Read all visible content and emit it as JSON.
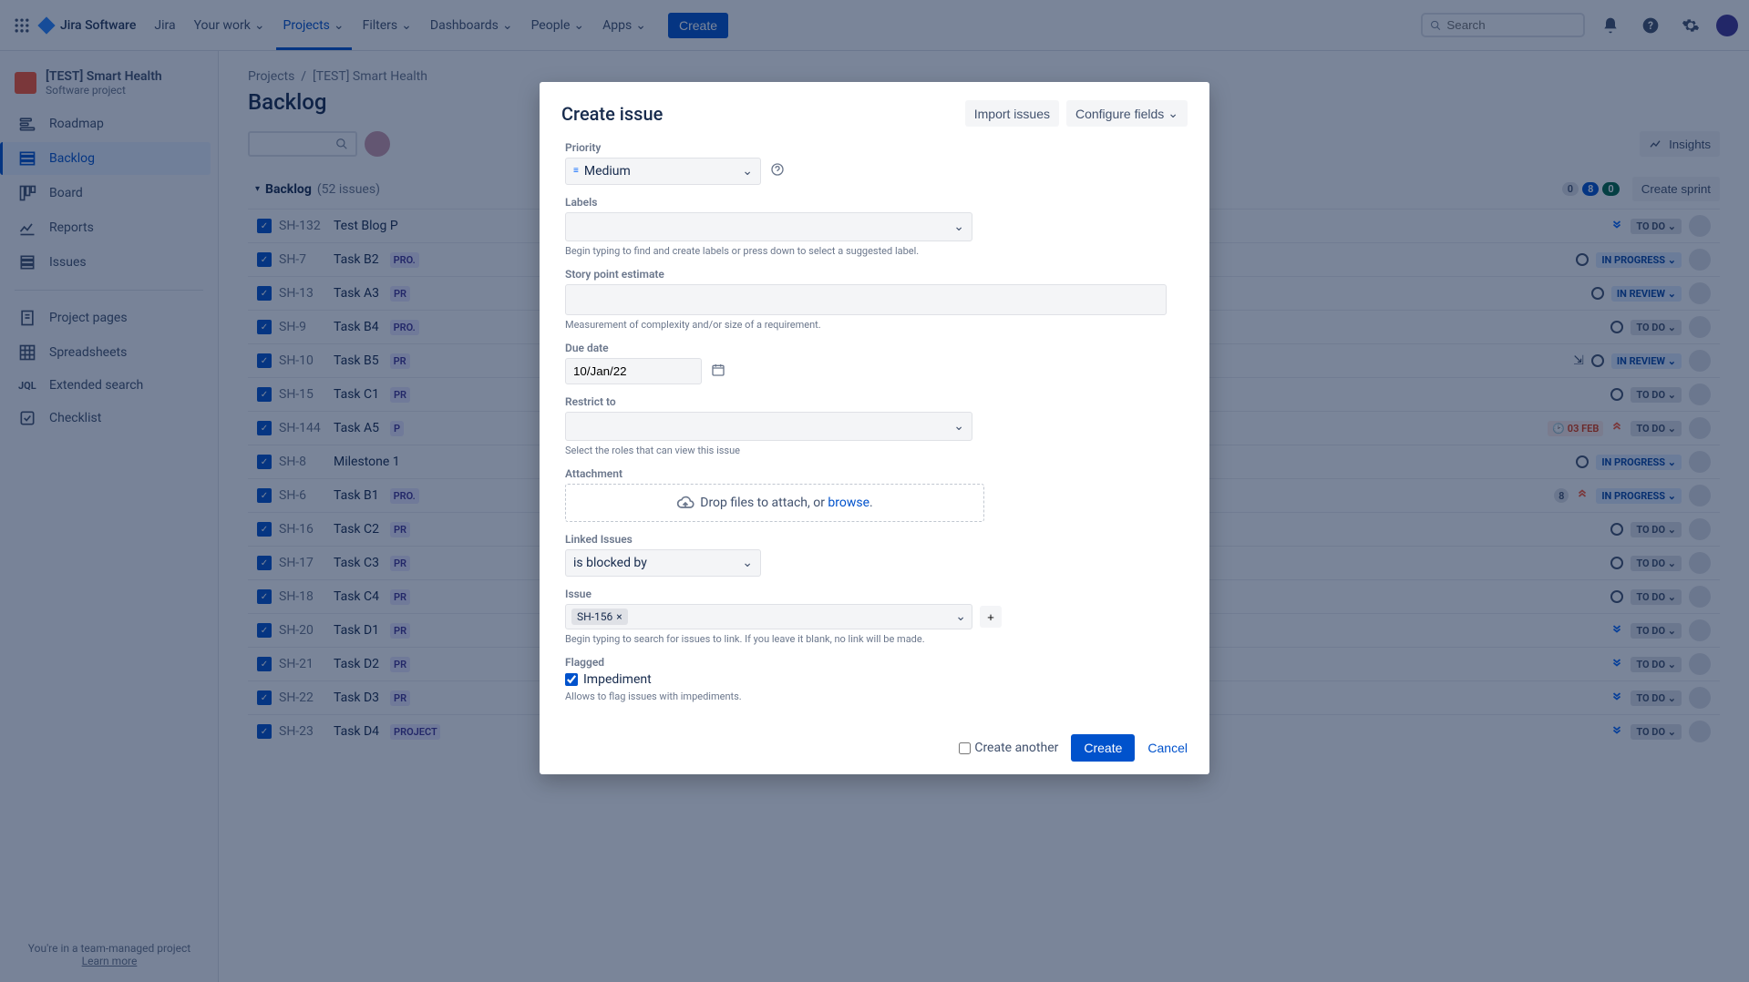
{
  "topnav": {
    "logo": "Jira Software",
    "items": [
      "Jira",
      "Your work",
      "Projects",
      "Filters",
      "Dashboards",
      "People",
      "Apps"
    ],
    "create": "Create",
    "search_placeholder": "Search"
  },
  "sidebar": {
    "project_name": "[TEST] Smart Health",
    "project_sub": "Software project",
    "nav": [
      {
        "label": "Roadmap"
      },
      {
        "label": "Backlog"
      },
      {
        "label": "Board"
      },
      {
        "label": "Reports"
      },
      {
        "label": "Issues"
      }
    ],
    "nav2": [
      {
        "label": "Project pages"
      },
      {
        "label": "Spreadsheets"
      },
      {
        "label": "Extended search"
      },
      {
        "label": "Checklist"
      }
    ],
    "footer_line1": "You're in a team-managed project",
    "footer_line2": "Learn more"
  },
  "breadcrumb": {
    "root": "Projects",
    "current": "[TEST] Smart Health"
  },
  "page_title": "Backlog",
  "insights": "Insights",
  "section": {
    "title": "Backlog",
    "count": "(52 issues)",
    "pills": [
      "0",
      "8",
      "0"
    ],
    "create_sprint": "Create sprint"
  },
  "issues": [
    {
      "key": "SH-132",
      "summary": "Test Blog P",
      "label": "",
      "status": "TO DO",
      "statusCls": "",
      "prio": "lowest",
      "hasCircle": false
    },
    {
      "key": "SH-7",
      "summary": "Task B2",
      "label": "PRO.",
      "status": "IN PROGRESS",
      "statusCls": "progress",
      "prio": "",
      "hasCircle": true
    },
    {
      "key": "SH-13",
      "summary": "Task A3",
      "label": "PR",
      "status": "IN REVIEW",
      "statusCls": "progress",
      "prio": "",
      "hasCircle": true
    },
    {
      "key": "SH-9",
      "summary": "Task B4",
      "label": "PRO.",
      "status": "TO DO",
      "statusCls": "",
      "prio": "",
      "hasCircle": true
    },
    {
      "key": "SH-10",
      "summary": "Task B5",
      "label": "PR",
      "status": "IN REVIEW",
      "statusCls": "progress",
      "prio": "",
      "hasCircle": true,
      "tree": true
    },
    {
      "key": "SH-15",
      "summary": "Task C1",
      "label": "PR",
      "status": "TO DO",
      "statusCls": "",
      "prio": "",
      "hasCircle": true
    },
    {
      "key": "SH-144",
      "summary": "Task A5",
      "label": "P",
      "status": "TO DO",
      "statusCls": "",
      "prio": "high",
      "due": "03 FEB"
    },
    {
      "key": "SH-8",
      "summary": "Milestone 1",
      "label": "",
      "status": "IN PROGRESS",
      "statusCls": "progress",
      "prio": "",
      "hasCircle": true
    },
    {
      "key": "SH-6",
      "summary": "Task B1",
      "label": "PRO.",
      "status": "IN PROGRESS",
      "statusCls": "progress",
      "prio": "high",
      "storypt": "8"
    },
    {
      "key": "SH-16",
      "summary": "Task C2",
      "label": "PR",
      "status": "TO DO",
      "statusCls": "",
      "prio": "",
      "hasCircle": true
    },
    {
      "key": "SH-17",
      "summary": "Task C3",
      "label": "PR",
      "status": "TO DO",
      "statusCls": "",
      "prio": "",
      "hasCircle": true
    },
    {
      "key": "SH-18",
      "summary": "Task C4",
      "label": "PR",
      "status": "TO DO",
      "statusCls": "",
      "prio": "",
      "hasCircle": true
    },
    {
      "key": "SH-20",
      "summary": "Task D1",
      "label": "PR",
      "status": "TO DO",
      "statusCls": "",
      "prio": "lowest",
      "hasCircle": false
    },
    {
      "key": "SH-21",
      "summary": "Task D2",
      "label": "PR",
      "status": "TO DO",
      "statusCls": "",
      "prio": "lowest",
      "hasCircle": false
    },
    {
      "key": "SH-22",
      "summary": "Task D3",
      "label": "PR",
      "status": "TO DO",
      "statusCls": "",
      "prio": "lowest",
      "hasCircle": false
    },
    {
      "key": "SH-23",
      "summary": "Task D4",
      "label": "PROJECT D",
      "status": "TO DO",
      "statusCls": "",
      "prio": "lowest",
      "hasCircle": false
    }
  ],
  "modal": {
    "title": "Create issue",
    "import": "Import issues",
    "configure": "Configure fields",
    "priority_label": "Priority",
    "priority_value": "Medium",
    "labels_label": "Labels",
    "labels_help": "Begin typing to find and create labels or press down to select a suggested label.",
    "story_label": "Story point estimate",
    "story_help": "Measurement of complexity and/or size of a requirement.",
    "due_label": "Due date",
    "due_value": "10/Jan/22",
    "restrict_label": "Restrict to",
    "restrict_help": "Select the roles that can view this issue",
    "attachment_label": "Attachment",
    "attachment_text": "Drop files to attach, or ",
    "attachment_browse": "browse",
    "linked_label": "Linked Issues",
    "linked_value": "is blocked by",
    "issue_label": "Issue",
    "issue_token": "SH-156",
    "issue_help": "Begin typing to search for issues to link. If you leave it blank, no link will be made.",
    "flagged_label": "Flagged",
    "flagged_check": "Impediment",
    "flagged_help": "Allows to flag issues with impediments.",
    "create_another": "Create another",
    "create_btn": "Create",
    "cancel_btn": "Cancel"
  }
}
